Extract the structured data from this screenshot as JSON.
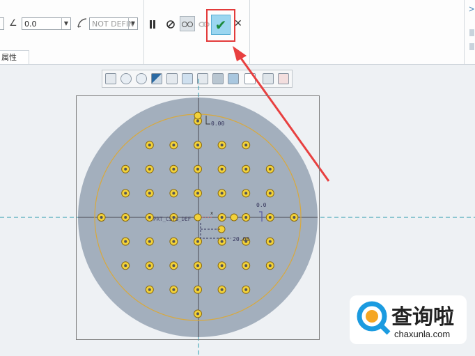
{
  "ribbon": {
    "angle_value": "0.0",
    "reference_value": "NOT DEFIN",
    "tab_label": "属性"
  },
  "controls": {
    "pause_icon": "pause-icon",
    "stop_icon": "no-entry-icon",
    "preview_icon": "glasses-preview-icon",
    "verify_icon": "link-icon",
    "ok_icon": "checkmark-icon",
    "cancel_icon": "close-icon"
  },
  "view_toolbar": {
    "icons": [
      "zoom-fit-icon",
      "zoom-in-icon",
      "zoom-out-icon",
      "repaint-icon",
      "orient-icon",
      "display-style-icon",
      "view-manager-icon",
      "saved-views-icon",
      "section-icon",
      "datum-display-icon",
      "annotation-icon",
      "spin-center-icon"
    ]
  },
  "canvas": {
    "label_top": "0.00",
    "label_right": "0.0",
    "label_center": "PRT_CSYS_DEF",
    "label_dim": "20.00",
    "colors": {
      "disc": "#a3afbd",
      "hole": "#f2d23a",
      "pattern_circle": "#d9a93c",
      "axis": "#2c9cae",
      "arrow": "#e84040"
    }
  },
  "watermark": {
    "title": "查询啦",
    "url": "chaxunla.com"
  }
}
